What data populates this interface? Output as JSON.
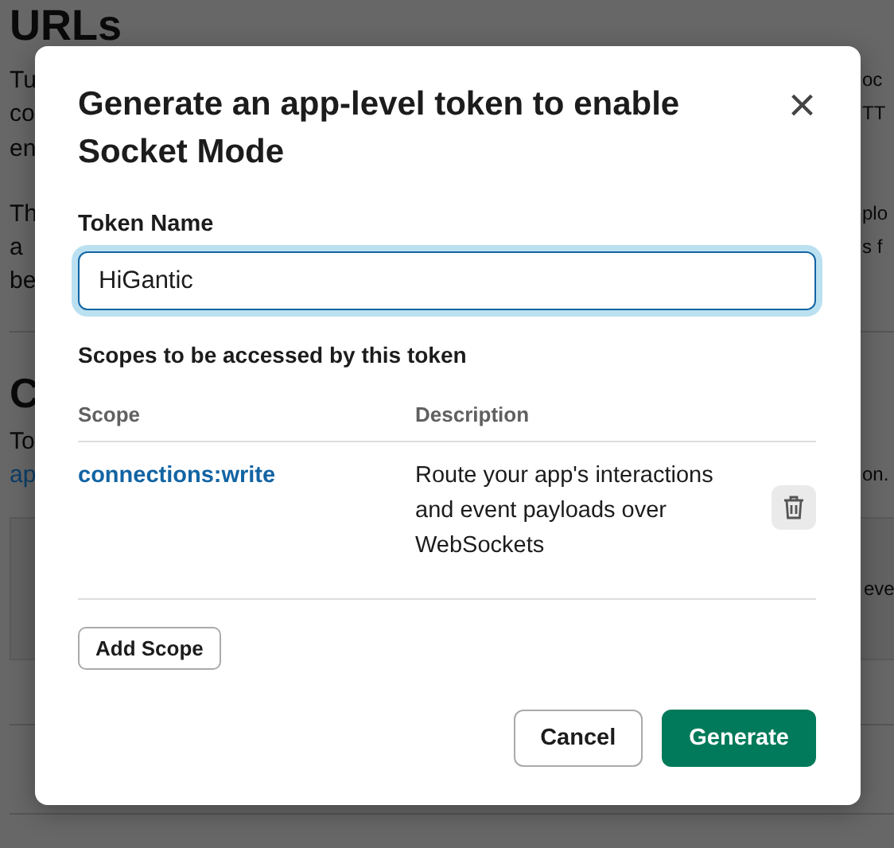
{
  "background": {
    "heading": "URLs",
    "paragraphs": [
      [
        {
          "left": "Tu",
          "right": "oc"
        },
        {
          "left": "co",
          "right": "TT"
        },
        {
          "left": "en"
        }
      ],
      [
        {
          "left": "Th",
          "right": "plo"
        },
        {
          "left": "a",
          "right": "s f"
        },
        {
          "left": "be"
        }
      ]
    ],
    "heading_2": "C",
    "lines_2": [
      {
        "left": "To",
        "kind": "text"
      },
      {
        "left": "ap",
        "right": "on.",
        "kind": "link"
      }
    ],
    "panel_text": "eve"
  },
  "dialog": {
    "title": "Generate an app-level token to enable Socket Mode",
    "close": "×",
    "token_label": "Token Name",
    "token_value": "HiGantic",
    "scopes_label": "Scopes to be accessed by this token",
    "columns": [
      "Scope",
      "Description"
    ],
    "rows": [
      {
        "scope": "connections:write",
        "description": "Route your app's interactions and event payloads over WebSockets"
      }
    ],
    "add_button": "Add Scope",
    "buttons": [
      {
        "label": "Cancel",
        "kind": "secondary"
      },
      {
        "label": "Generate",
        "kind": "primary"
      }
    ]
  }
}
